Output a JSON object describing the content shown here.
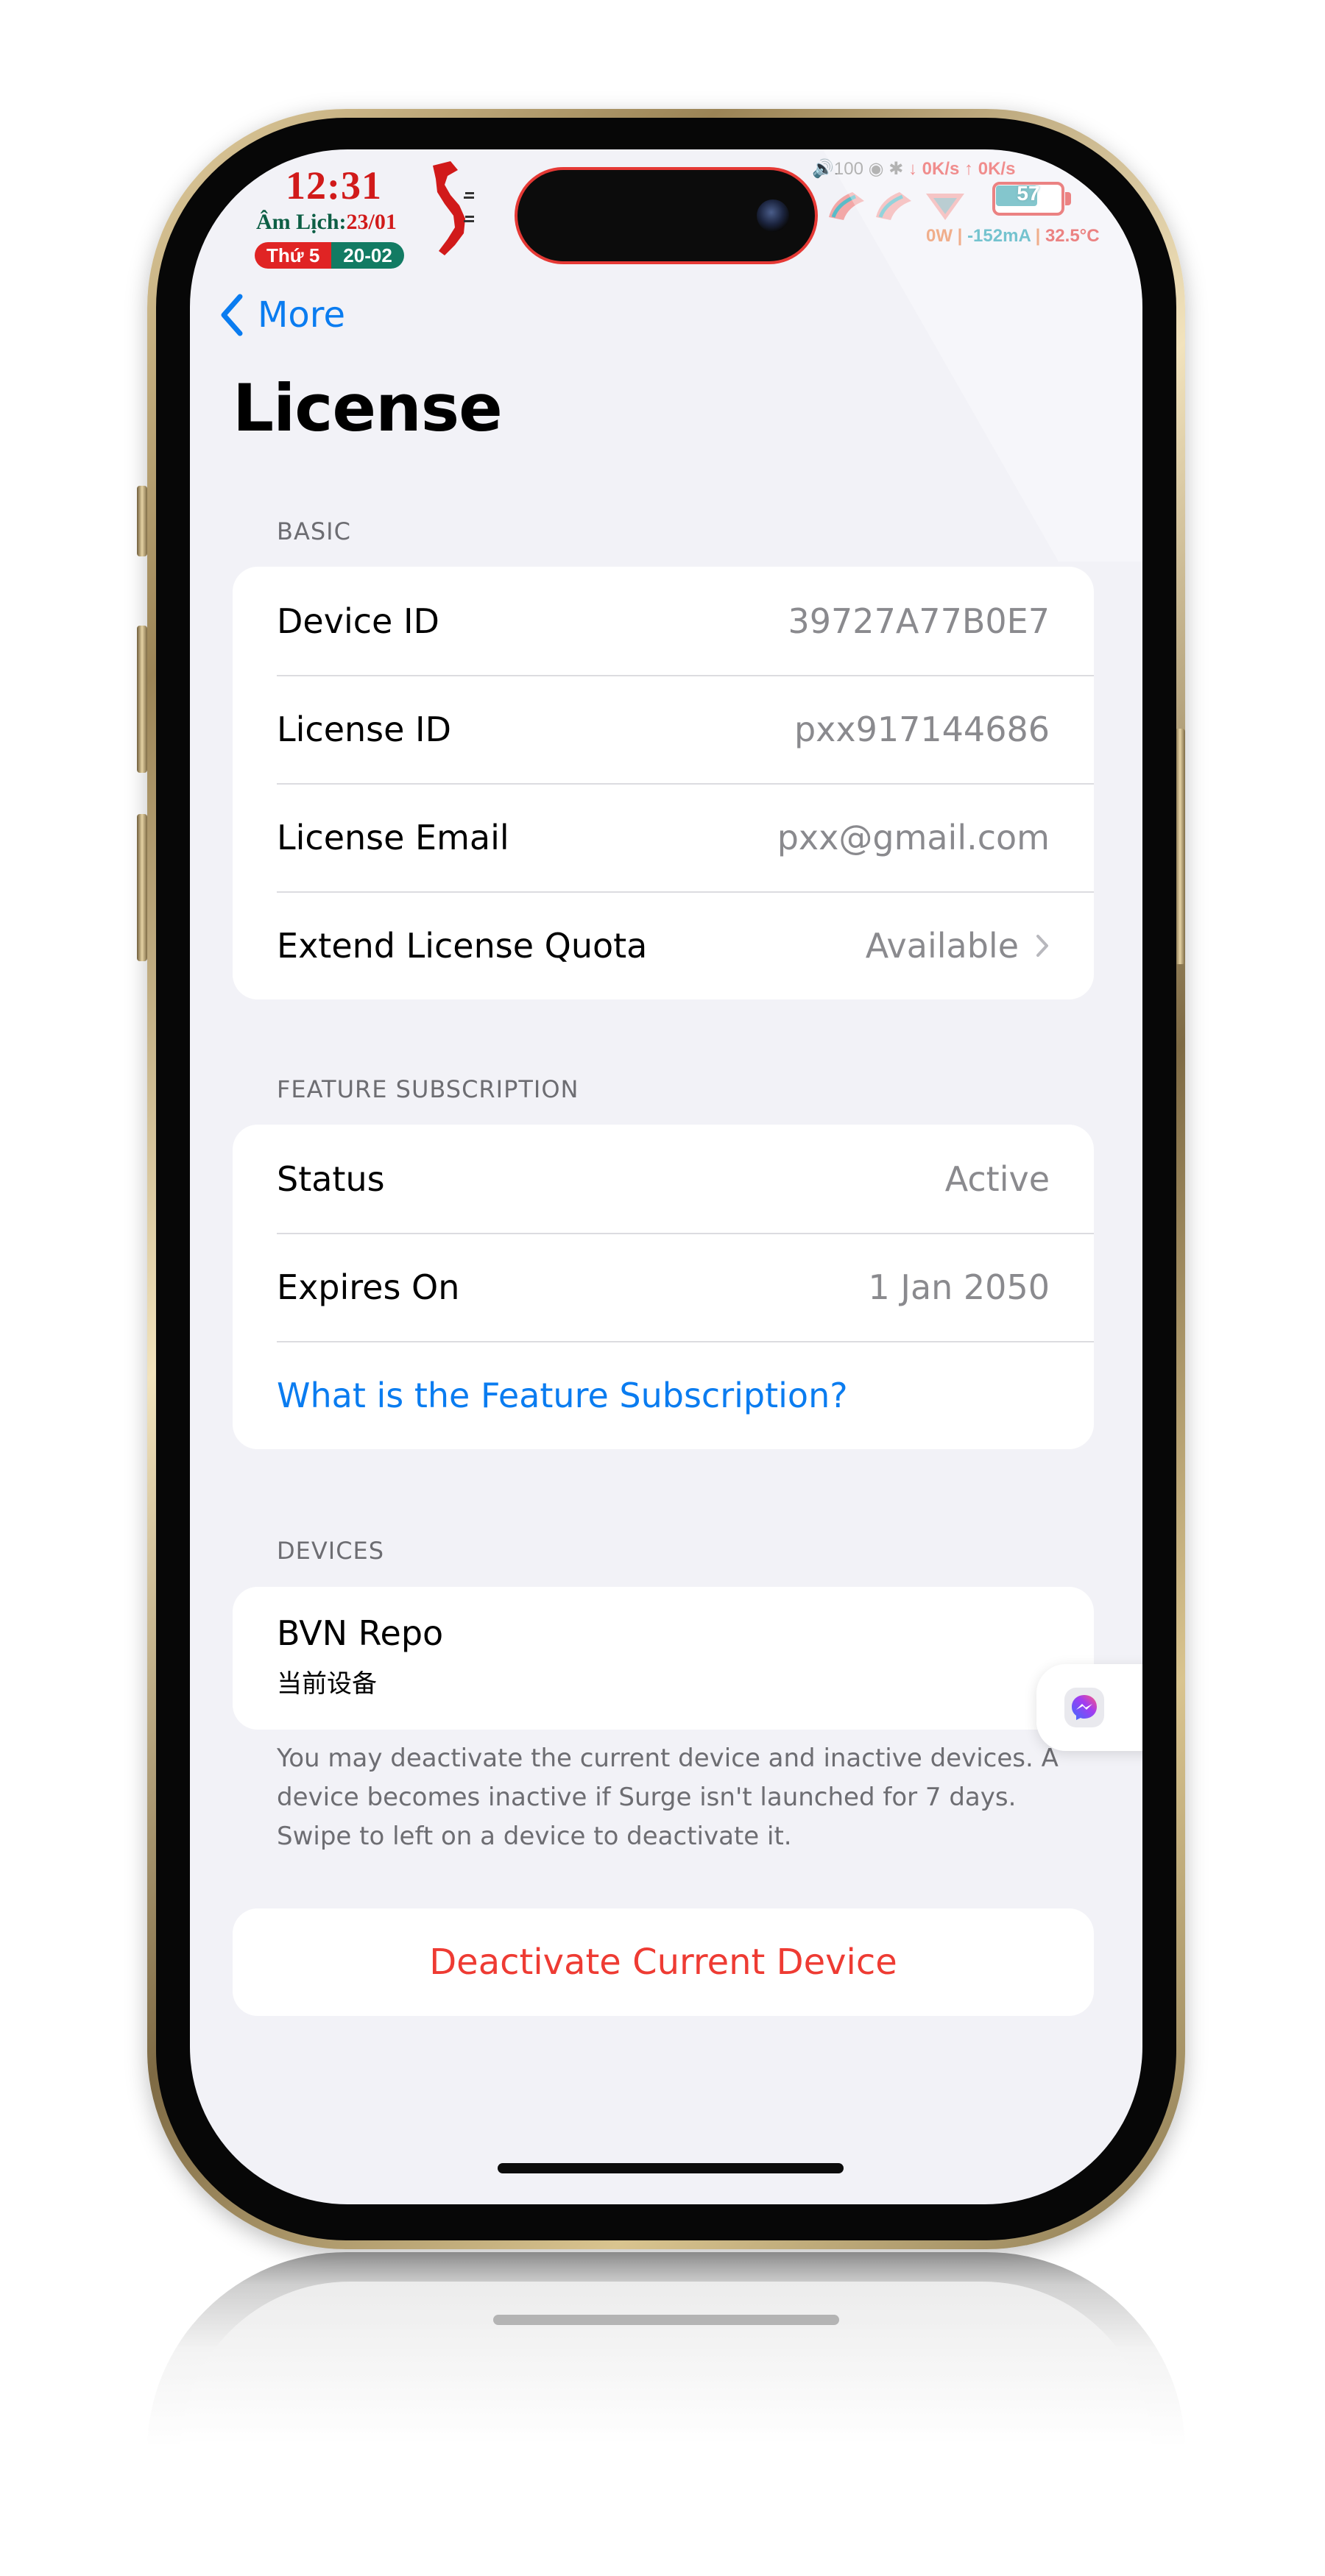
{
  "status_bar": {
    "time": "12:31",
    "lunar_prefix": "Âm Lịch:",
    "lunar_date": "23/01",
    "weekday": "Thứ 5",
    "date": "20-02",
    "volume": "🔊100",
    "download_speed": "↓ 0K/s",
    "upload_speed": "↑ 0K/s",
    "battery_level": "57",
    "power": "0W",
    "current": "-152mA",
    "temperature": "32.5°C",
    "separator": "|"
  },
  "nav": {
    "back_label": "More",
    "title": "License"
  },
  "sections": {
    "basic": {
      "header": "BASIC",
      "rows": [
        {
          "label": "Device ID",
          "value": "39727A77B0E7"
        },
        {
          "label": "License ID",
          "value": "pxx917144686"
        },
        {
          "label": "License Email",
          "value": "pxx@gmail.com"
        },
        {
          "label": "Extend License Quota",
          "value": "Available"
        }
      ]
    },
    "feature_subscription": {
      "header": "FEATURE SUBSCRIPTION",
      "rows": [
        {
          "label": "Status",
          "value": "Active"
        },
        {
          "label": "Expires On",
          "value": "1 Jan 2050"
        }
      ],
      "link": "What is the Feature Subscription?"
    },
    "devices": {
      "header": "DEVICES",
      "device_name": "BVN Repo",
      "device_subtitle": "当前设备",
      "footnote": "You may deactivate the current device and inactive devices. A device becomes inactive if Surge isn't launched for 7 days. Swipe to left on a device to deactivate it."
    }
  },
  "actions": {
    "deactivate_label": "Deactivate Current Device"
  },
  "colors": {
    "accent": "#0a7cf0",
    "destructive": "#ee3b33",
    "background": "#f2f2f7",
    "secondary_text": "#8a8a8e",
    "frame_gold": "#c9b27c"
  },
  "icons": [
    "chevron-left-icon",
    "chevron-right-icon",
    "messenger-icon",
    "camera-icon",
    "battery-icon",
    "vietnam-map-icon",
    "volume-icon",
    "bluetooth-icon"
  ]
}
